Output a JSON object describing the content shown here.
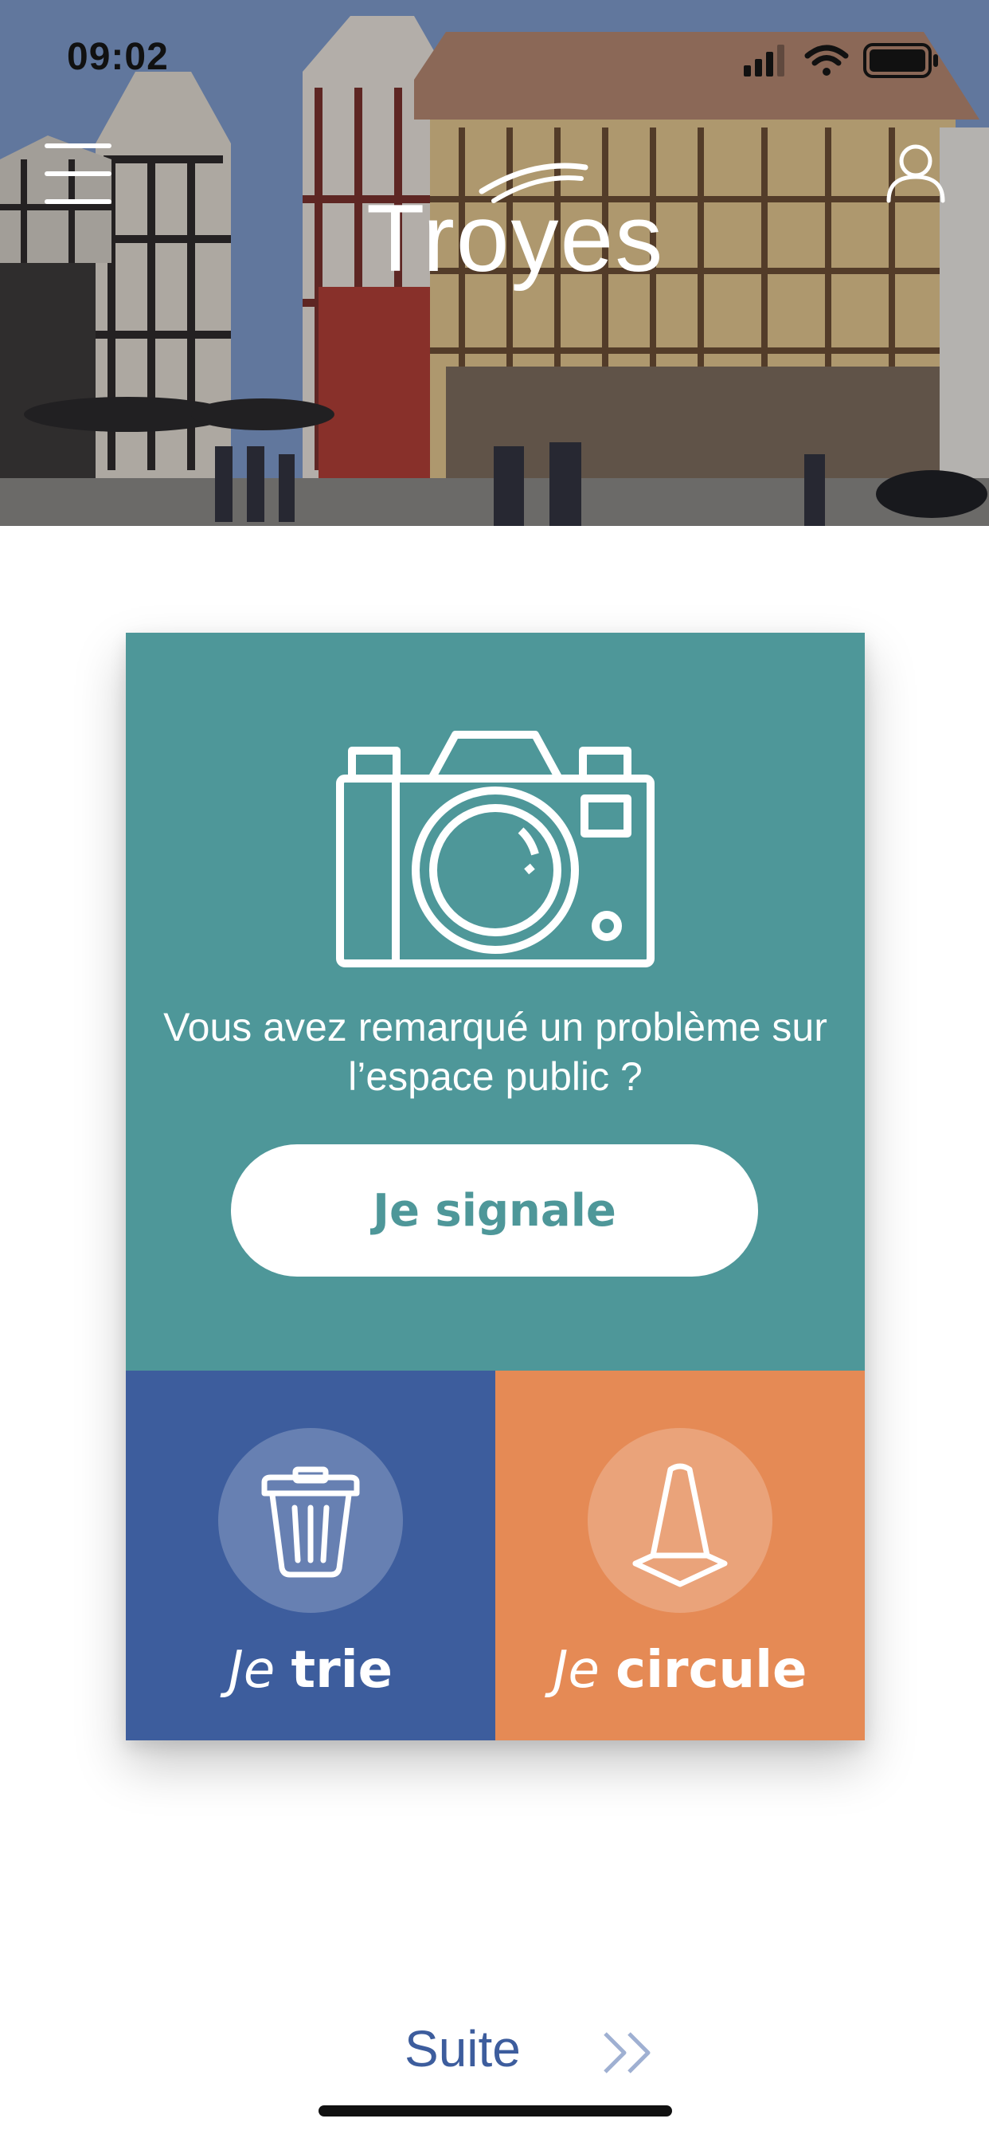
{
  "status_bar": {
    "time": "09:02",
    "icons": [
      "signal-icon",
      "wifi-icon",
      "battery-icon"
    ]
  },
  "header": {
    "logo_text": "Troyes",
    "menu_icon": "hamburger-icon",
    "profile_icon": "user-icon"
  },
  "report": {
    "icon": "camera-icon",
    "question": "Vous avez remarqué un problème sur l’espace public ?",
    "button_label": "Je signale"
  },
  "tiles": [
    {
      "pre": "Je",
      "label": "trie",
      "icon": "trash-icon",
      "color": "#3d5d9d"
    },
    {
      "pre": "Je",
      "label": "circule",
      "icon": "traffic-cone-icon",
      "color": "#e58a55"
    }
  ],
  "footer": {
    "next_label": "Suite",
    "next_icon": "double-chevron-right-icon"
  },
  "colors": {
    "teal": "#4e9799",
    "blue": "#3d5d9d",
    "orange": "#e58a55",
    "white": "#ffffff"
  }
}
